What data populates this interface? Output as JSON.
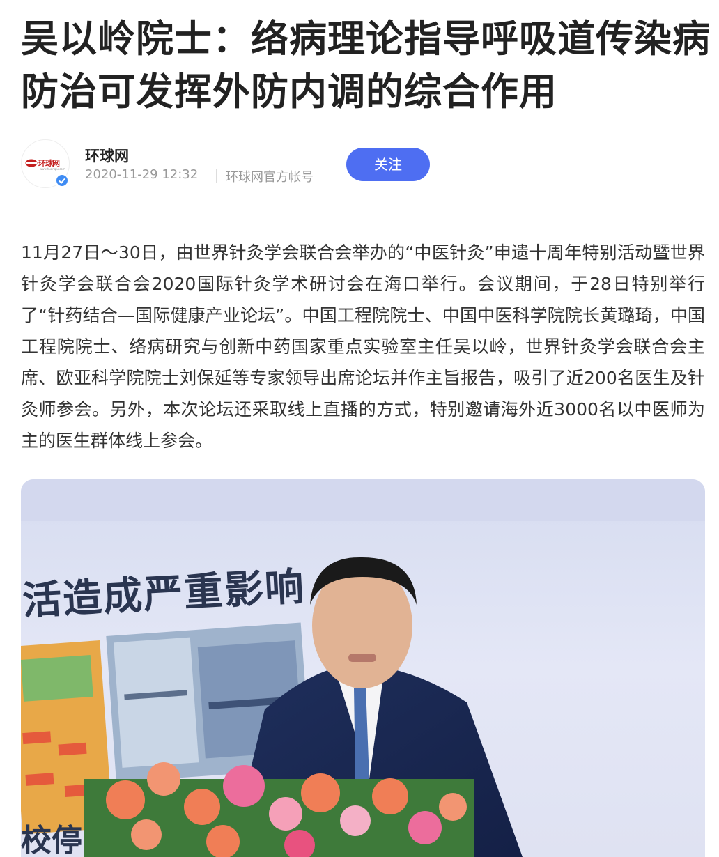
{
  "article": {
    "title": "吴以岭院士：络病理论指导呼吸道传染病防治可发挥外防内调的综合作用",
    "body": "11月27日～30日，由世界针灸学会联合会举办的“中医针灸”申遗十周年特别活动暨世界针灸学会联合会2020国际针灸学术研讨会在海口举行。会议期间，于28日特别举行了“针药结合—国际健康产业论坛”。中国工程院院士、中国中医科学院院长黄璐琦，中国工程院院士、络病研究与创新中药国家重点实验室主任吴以岭，世界针灸学会联合会主席、欧亚科学院院士刘保延等专家领导出席论坛并作主旨报告，吸引了近200名医生及针灸师参会。另外，本次论坛还采取线上直播的方式，特别邀请海外近3000名以中医师为主的医生群体线上参会。"
  },
  "author": {
    "name": "环球网",
    "date": "2020-11-29 12:32",
    "account_type": "环球网官方帐号",
    "avatar_logo_text": "环球网",
    "avatar_logo_sub": "www.huanqiu.com",
    "avatar_icon": "huanqiu-logo-icon",
    "verified_icon": "verified-badge-icon"
  },
  "actions": {
    "follow_label": "关注"
  },
  "photo": {
    "screen_text_top": "活造成严重影响",
    "screen_text_bottom": "校停"
  },
  "colors": {
    "accent": "#4e6ef2",
    "verified": "#3f8cf4",
    "brand_red": "#c41f1f"
  }
}
